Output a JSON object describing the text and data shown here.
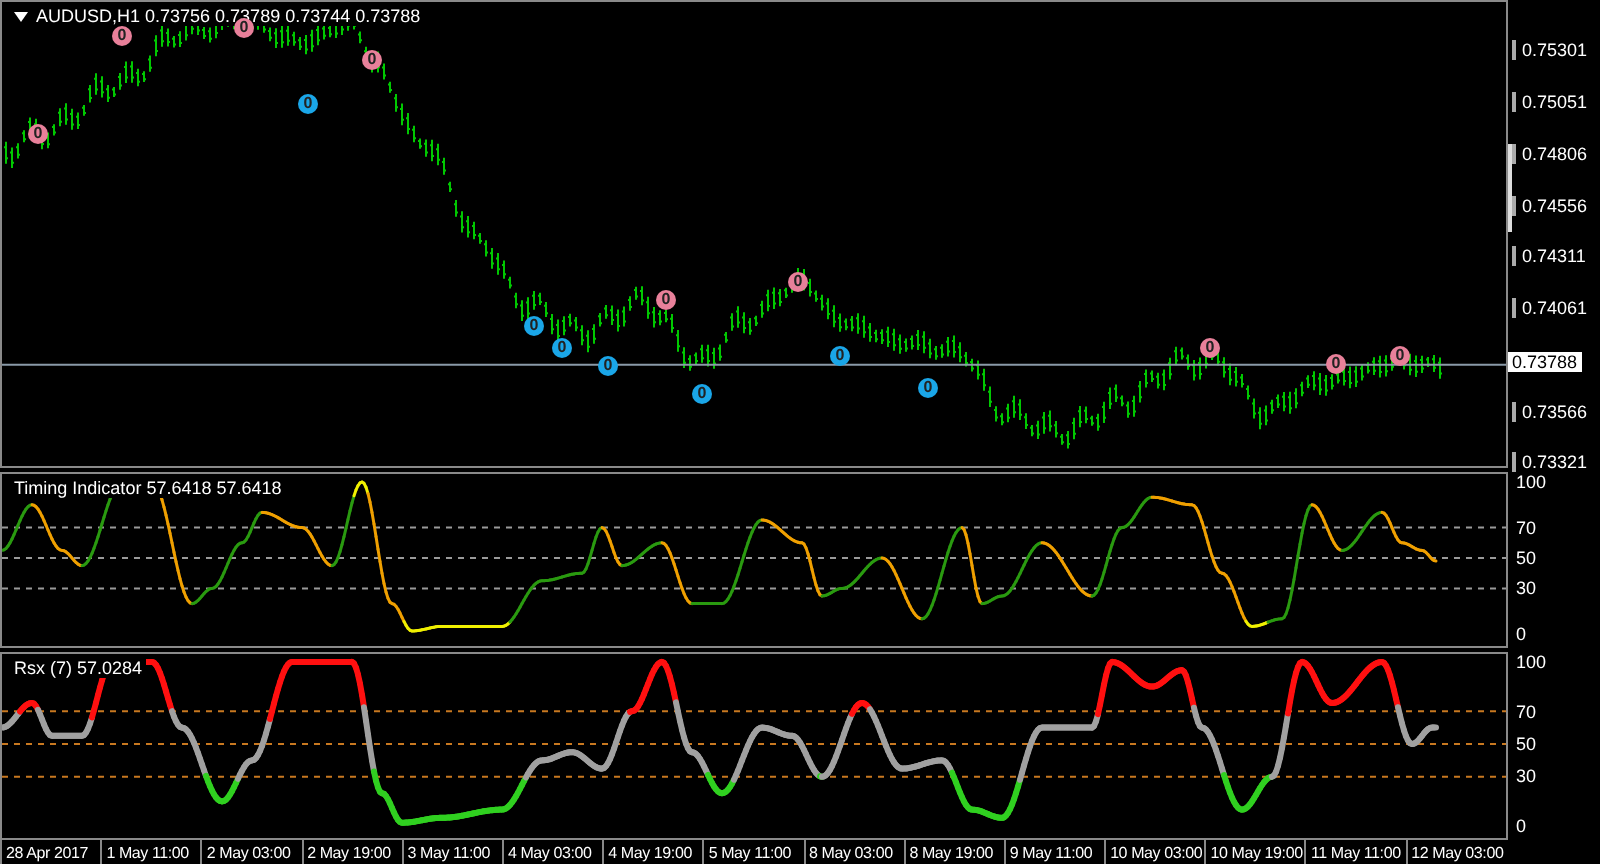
{
  "chart": {
    "title": "AUDUSD,H1 0.73756 0.73789 0.73744 0.73788",
    "current_price": "0.73788",
    "price_axis": [
      "0.75301",
      "0.75051",
      "0.74806",
      "0.74556",
      "0.74311",
      "0.74061",
      "0.73566",
      "0.73321"
    ],
    "markers": [
      {
        "label": "0",
        "color": "#e8809a"
      },
      {
        "label": "0",
        "color": "#e8809a"
      },
      {
        "label": "0",
        "color": "#e8809a"
      },
      {
        "label": "0",
        "color": "#1aa6e8"
      },
      {
        "label": "0",
        "color": "#e8809a"
      },
      {
        "label": "0",
        "color": "#1aa6e8"
      },
      {
        "label": "0",
        "color": "#1aa6e8"
      },
      {
        "label": "0",
        "color": "#1aa6e8"
      },
      {
        "label": "0",
        "color": "#e8809a"
      },
      {
        "label": "0",
        "color": "#1aa6e8"
      },
      {
        "label": "0",
        "color": "#e8809a"
      },
      {
        "label": "0",
        "color": "#1aa6e8"
      },
      {
        "label": "0",
        "color": "#1aa6e8"
      },
      {
        "label": "0",
        "color": "#e8809a"
      },
      {
        "label": "0",
        "color": "#e8809a"
      },
      {
        "label": "0",
        "color": "#e8809a"
      }
    ]
  },
  "indicators": [
    {
      "label": "Timing Indicator 57.6418 57.6418",
      "levels": [
        "100",
        "70",
        "50",
        "30",
        "0"
      ],
      "kind": "timing"
    },
    {
      "label": "Rsx (7) 57.0284",
      "levels": [
        "100",
        "70",
        "50",
        "30",
        "0"
      ],
      "kind": "rsx"
    }
  ],
  "time_axis": [
    "28 Apr 2017",
    "1 May 11:00",
    "2 May 03:00",
    "2 May 19:00",
    "3 May 11:00",
    "4 May 03:00",
    "4 May 19:00",
    "5 May 11:00",
    "8 May 03:00",
    "8 May 19:00",
    "9 May 11:00",
    "10 May 03:00",
    "10 May 19:00",
    "11 May 11:00",
    "12 May 03:00"
  ]
}
